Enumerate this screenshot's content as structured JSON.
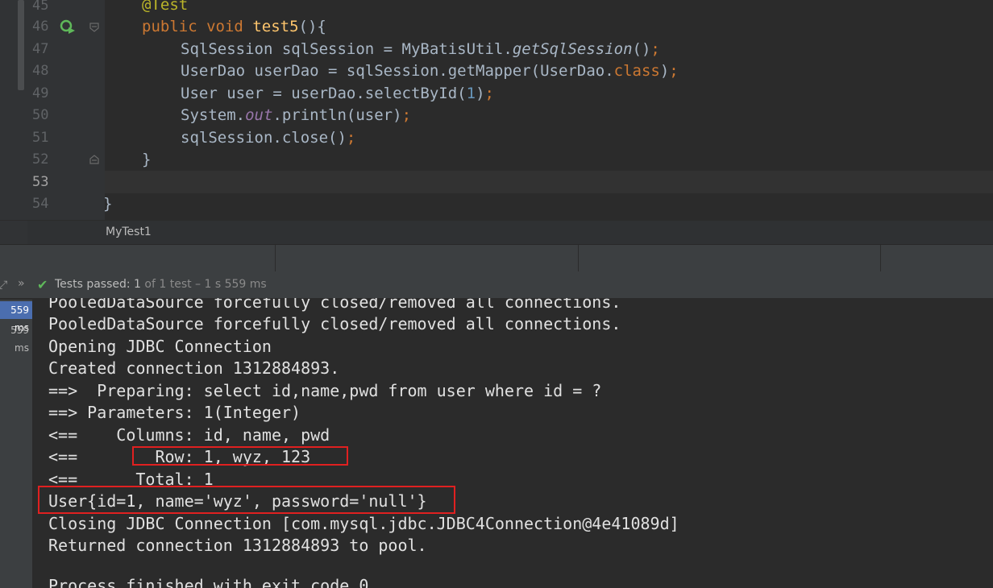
{
  "editor": {
    "line_numbers": [
      "45",
      "46",
      "47",
      "48",
      "49",
      "50",
      "51",
      "52",
      "53",
      "54"
    ],
    "annotation": "@Test",
    "signature": {
      "kw1": "public",
      "kw2": "void",
      "name": "test5",
      "rest": "(){"
    },
    "lines": {
      "l47": {
        "a": "SqlSession sqlSession = MyBatisUtil.",
        "m": "getSqlSession",
        "b": "()",
        "s": ";"
      },
      "l48": {
        "a": "UserDao userDao = sqlSession.getMapper(UserDao.",
        "k": "class",
        "b": ")",
        "s": ";"
      },
      "l49": {
        "a": "User user = userDao.selectById(",
        "n": "1",
        "b": ")",
        "s": ";"
      },
      "l50": {
        "a": "System.",
        "st": "out",
        "b": ".println(user)",
        "s": ";"
      },
      "l51": {
        "a": "sqlSession.close()",
        "s": ";"
      },
      "l52": "}",
      "l54": "}"
    },
    "breadcrumb": "MyTest1",
    "icons": {
      "run": "run-test-icon",
      "fold": "fold-icon"
    }
  },
  "test_toolbar": {
    "status_label": "Tests passed:",
    "count": "1",
    "detail": "of 1 test – 1 s 559 ms",
    "icons": {
      "expand": "expand-icon",
      "chevron": "chevron-icon",
      "check": "check-icon"
    },
    "check_color": "#5fb85a"
  },
  "test_tree": {
    "rows": [
      "559 ms",
      "559 ms"
    ]
  },
  "console": {
    "lines": [
      "PooledDataSource forcefully closed/removed all connections.",
      "PooledDataSource forcefully closed/removed all connections.",
      "Opening JDBC Connection",
      "Created connection 1312884893.",
      "==>  Preparing: select id,name,pwd from user where id = ? ",
      "==> Parameters: 1(Integer)",
      "<==    Columns: id, name, pwd",
      "<==        Row: 1, wyz, 123",
      "<==      Total: 1",
      "User{id=1, name='wyz', password='null'}",
      "Closing JDBC Connection [com.mysql.jdbc.JDBC4Connection@4e41089d]",
      "Returned connection 1312884893 to pool.",
      "",
      "Process finished with exit code 0"
    ],
    "highlight_color": "#e02020"
  }
}
